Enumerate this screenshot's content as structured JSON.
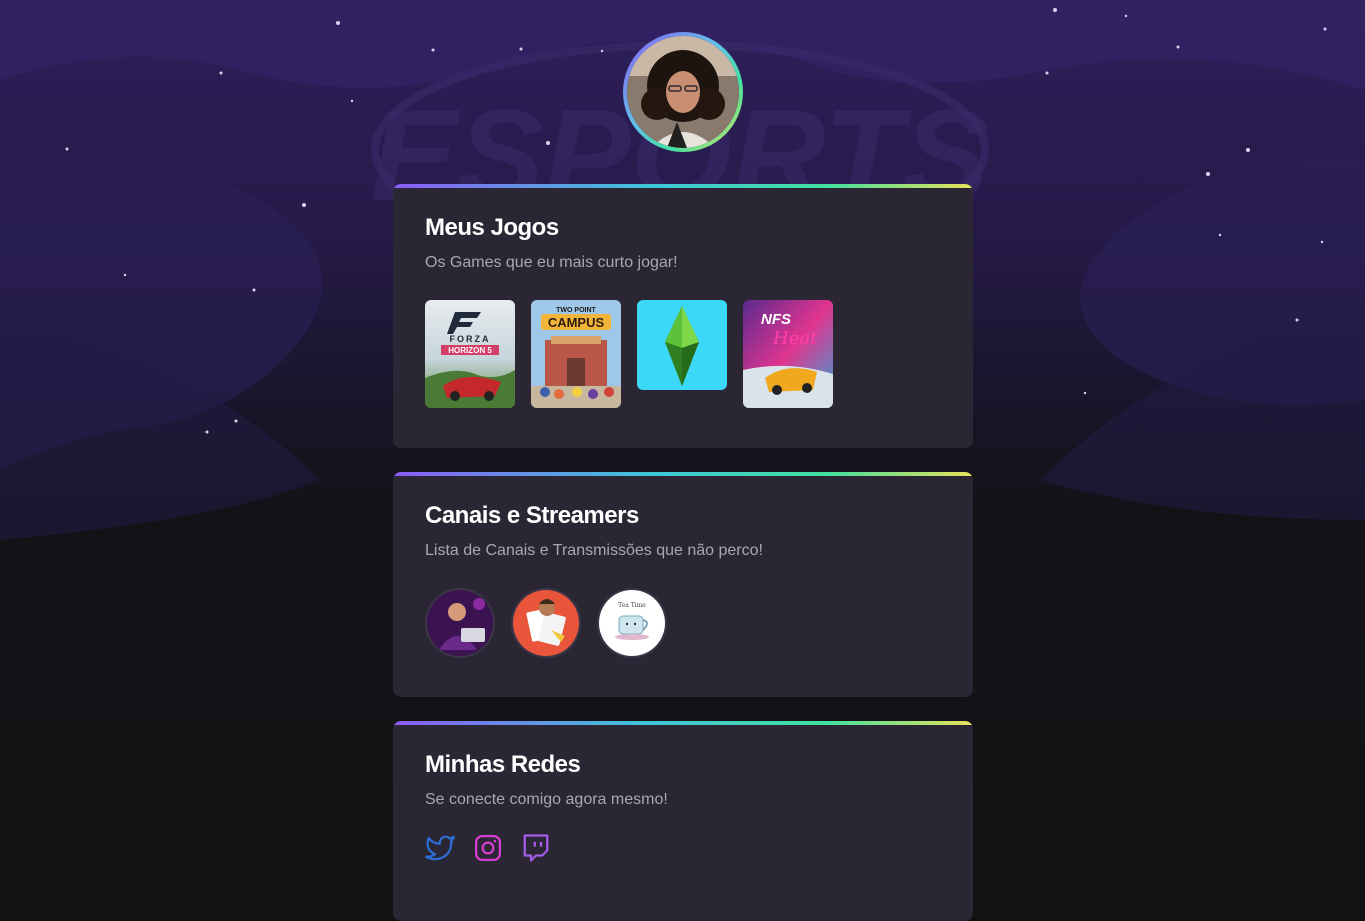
{
  "profile": {
    "avatar_alt": "Foto de perfil"
  },
  "background": {
    "watermark": "ESPORTS"
  },
  "cards": {
    "games": {
      "title": "Meus Jogos",
      "subtitle": "Os Games que eu mais curto jogar!",
      "items": [
        {
          "name": "forza-horizon-5",
          "logo_top": "FORZA",
          "logo_bottom": "HORIZON 5"
        },
        {
          "name": "two-point-campus",
          "logo_top": "TWO POINT",
          "logo_bottom": "CAMPUS"
        },
        {
          "name": "the-sims",
          "logo_top": "",
          "logo_bottom": ""
        },
        {
          "name": "need-for-speed-heat",
          "logo_top": "NFS",
          "logo_bottom": "Heat"
        }
      ]
    },
    "channels": {
      "title": "Canais e Streamers",
      "subtitle": "Lista de Canais e Transmissões que não perco!",
      "items": [
        {
          "name": "channel-1"
        },
        {
          "name": "channel-2"
        },
        {
          "name": "channel-3",
          "label": "Tea Time"
        }
      ]
    },
    "socials": {
      "title": "Minhas Redes",
      "subtitle": "Se conecte comigo agora mesmo!",
      "items": [
        {
          "name": "twitter",
          "icon": "twitter-icon",
          "color": "#2b6fd6"
        },
        {
          "name": "instagram",
          "icon": "instagram-icon",
          "color": "#d63fd0"
        },
        {
          "name": "twitch",
          "icon": "twitch-icon",
          "color": "#a35ce8"
        }
      ]
    }
  },
  "colors": {
    "accent_gradient": [
      "#8b5cf6",
      "#3ec7d8",
      "#44e0a0",
      "#e9e25a"
    ],
    "card_bg": "#2a2634",
    "page_bg": "#121214"
  }
}
